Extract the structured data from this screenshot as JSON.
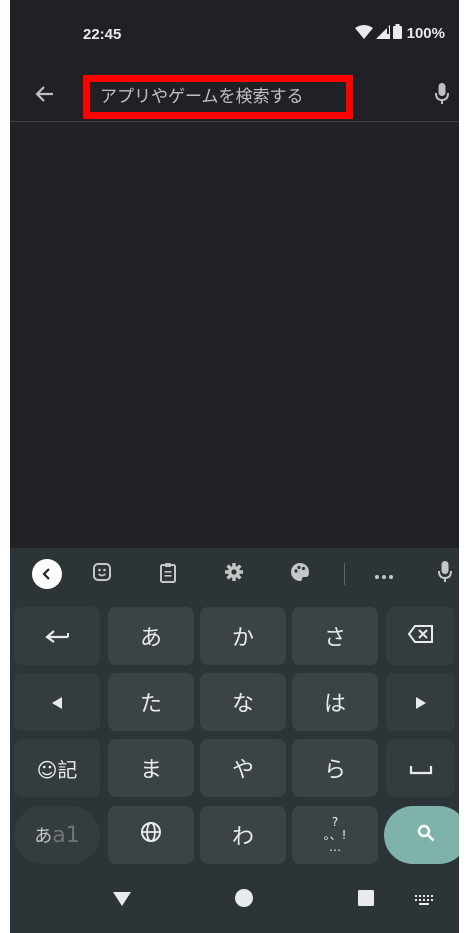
{
  "status_bar": {
    "time": "22:45",
    "battery": "100%"
  },
  "search": {
    "placeholder": "アプリやゲームを検索する"
  },
  "keyboard": {
    "row1": [
      "あ",
      "か",
      "さ"
    ],
    "row2": [
      "た",
      "な",
      "は"
    ],
    "row3": [
      "ま",
      "や",
      "ら"
    ],
    "row4_middle": "わ",
    "emoji_key_label": "☺記",
    "mode_key_label_main": "あ",
    "mode_key_label_sub": "a1",
    "punct_top": "?",
    "punct_mid": "。、!",
    "punct_bottom": "…"
  },
  "icons": {
    "back": "arrow-left-icon",
    "mic": "microphone-icon",
    "wifi": "wifi-icon",
    "signal": "signal-icon",
    "battery": "battery-icon"
  },
  "colors": {
    "highlight_box": "#ff0000",
    "search_key": "#7fb3aa",
    "background": "#202124",
    "keyboard": "#2d3437"
  }
}
